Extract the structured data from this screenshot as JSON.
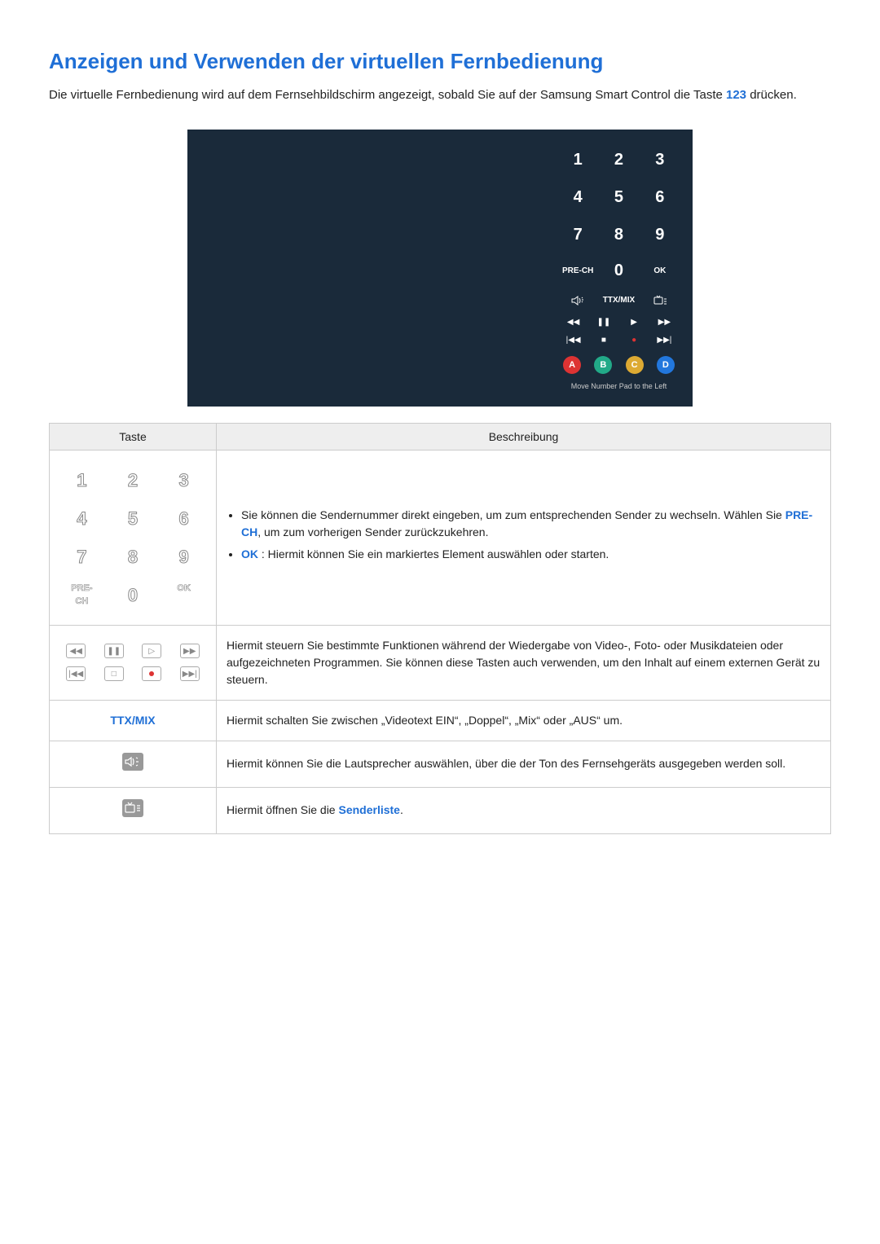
{
  "title": "Anzeigen und Verwenden der virtuellen Fernbedienung",
  "intro_pre": "Die virtuelle Fernbedienung wird auf dem Fernsehbildschirm angezeigt, sobald Sie auf der Samsung Smart Control die Taste ",
  "intro_key": "123",
  "intro_post": " drücken.",
  "tv": {
    "numbers": [
      "1",
      "2",
      "3",
      "4",
      "5",
      "6",
      "7",
      "8",
      "9"
    ],
    "row4": {
      "left": "PRE-CH",
      "mid": "0",
      "right": "OK"
    },
    "midrow_center": "TTX/MIX",
    "color_labels": [
      "A",
      "B",
      "C",
      "D"
    ],
    "footer": "Move Number Pad to the Left"
  },
  "table": {
    "head_key": "Taste",
    "head_desc": "Beschreibung",
    "row_numpad": {
      "keys_nums": [
        "1",
        "2",
        "3",
        "4",
        "5",
        "6",
        "7",
        "8",
        "9"
      ],
      "keys_row4": [
        "PRE-CH",
        "0",
        "OK"
      ],
      "bullet1_pre": "Sie können die Sendernummer direkt eingeben, um zum entsprechenden Sender zu wechseln. Wählen Sie ",
      "bullet1_key": "PRE-CH",
      "bullet1_post": ", um zum vorherigen Sender zurückzukehren.",
      "bullet2_key": "OK",
      "bullet2_post": " : Hiermit können Sie ein markiertes Element auswählen oder starten."
    },
    "row_transport": {
      "desc": "Hiermit steuern Sie bestimmte Funktionen während der Wiedergabe von Video-, Foto- oder Musikdateien oder aufgezeichneten Programmen. Sie können diese Tasten auch verwenden, um den Inhalt auf einem externen Gerät zu steuern."
    },
    "row_ttx": {
      "label": "TTX/MIX",
      "desc": "Hiermit schalten Sie zwischen „Videotext EIN“, „Doppel“, „Mix“ oder „AUS“ um."
    },
    "row_speaker": {
      "desc": "Hiermit können Sie die Lautsprecher auswählen, über die der Ton des Fernsehgeräts ausgegeben werden soll."
    },
    "row_chlist": {
      "desc_pre": "Hiermit öffnen Sie die ",
      "desc_key": "Senderliste",
      "desc_post": "."
    }
  }
}
